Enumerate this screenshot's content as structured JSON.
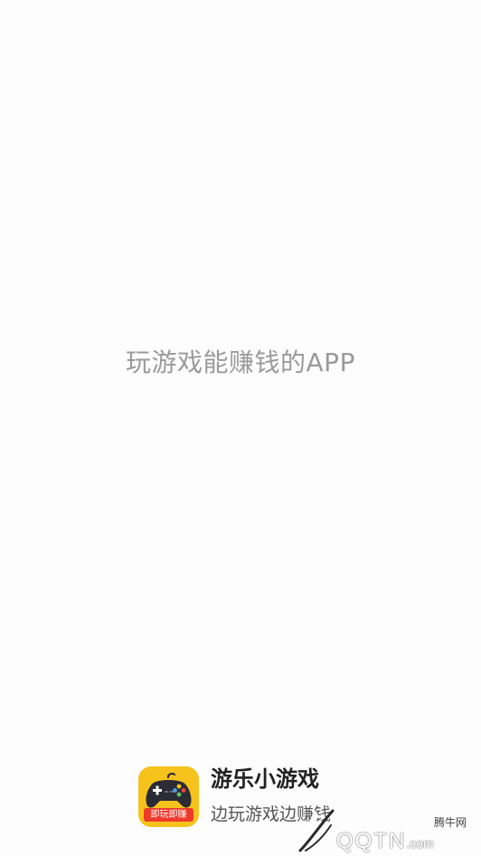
{
  "splash": {
    "slogan": "玩游戏能赚钱的APP"
  },
  "footer": {
    "app_name": "游乐小游戏",
    "tagline": "边玩游戏边赚钱",
    "logo": {
      "icon": "gamepad-icon",
      "ribbon_text": "即玩即赚",
      "colors": {
        "background": "#f6c21c",
        "ribbon": "#ee3a2b",
        "controller": "#2b2b35"
      }
    }
  },
  "watermark": {
    "top_text": "腾牛网",
    "brand": "QQTN",
    "suffix": ".com"
  }
}
